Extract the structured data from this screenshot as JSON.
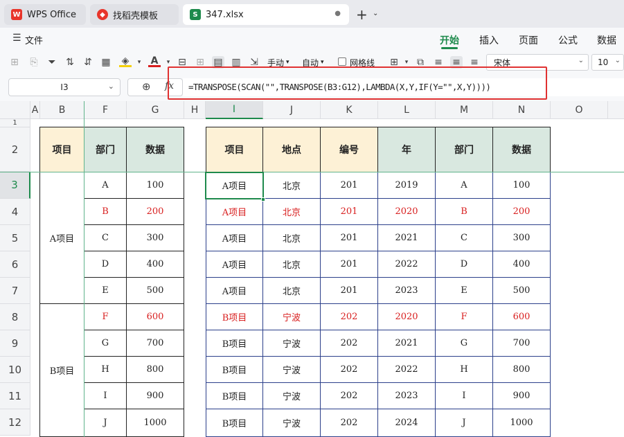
{
  "tabs": [
    {
      "label": "WPS Office",
      "icon": "wps-logo-icon"
    },
    {
      "label": "找稻壳模板",
      "icon": "docer-icon"
    },
    {
      "label": "347.xlsx",
      "icon": "sheet-icon"
    }
  ],
  "menu": {
    "file": "文件",
    "items": [
      "开始",
      "插入",
      "页面",
      "公式",
      "数据"
    ],
    "active": "开始"
  },
  "toolbar": {
    "wrap_manual": "手动",
    "wrap_auto": "自动",
    "gridlines": "网格线",
    "font_name": "宋体",
    "font_size": "10"
  },
  "formula": {
    "cell_ref": "I3",
    "fx": "fx",
    "text": "=TRANSPOSE(SCAN(\"\",TRANSPOSE(B3:G12),LAMBDA(X,Y,IF(Y=\"\",X,Y))))"
  },
  "columns": [
    "A",
    "B",
    "F",
    "G",
    "H",
    "I",
    "J",
    "K",
    "L",
    "M",
    "N",
    "O"
  ],
  "rows": [
    "1",
    "2",
    "3",
    "4",
    "5",
    "6",
    "7",
    "8",
    "9",
    "10",
    "11",
    "12"
  ],
  "left_table": {
    "headers": [
      "项目",
      "部门",
      "数据"
    ],
    "groups": [
      "A项目",
      "B项目"
    ],
    "dept": [
      "A",
      "B",
      "C",
      "D",
      "E",
      "F",
      "G",
      "H",
      "I",
      "J"
    ],
    "values": [
      "100",
      "200",
      "300",
      "400",
      "500",
      "600",
      "700",
      "800",
      "900",
      "1000"
    ]
  },
  "right_table": {
    "headers": [
      "项目",
      "地点",
      "编号",
      "年",
      "部门",
      "数据"
    ],
    "rows": [
      [
        "A项目",
        "北京",
        "201",
        "2019",
        "A",
        "100"
      ],
      [
        "A项目",
        "北京",
        "201",
        "2020",
        "B",
        "200"
      ],
      [
        "A项目",
        "北京",
        "201",
        "2021",
        "C",
        "300"
      ],
      [
        "A项目",
        "北京",
        "201",
        "2022",
        "D",
        "400"
      ],
      [
        "A项目",
        "北京",
        "201",
        "2023",
        "E",
        "500"
      ],
      [
        "B项目",
        "宁波",
        "202",
        "2020",
        "F",
        "600"
      ],
      [
        "B项目",
        "宁波",
        "202",
        "2021",
        "G",
        "700"
      ],
      [
        "B项目",
        "宁波",
        "202",
        "2022",
        "H",
        "800"
      ],
      [
        "B项目",
        "宁波",
        "202",
        "2023",
        "I",
        "900"
      ],
      [
        "B项目",
        "宁波",
        "202",
        "2024",
        "J",
        "1000"
      ]
    ]
  },
  "colors": {
    "header_yellow": "#fdf1d6",
    "header_green": "#d9e8e0",
    "red_text": "#d81e1e",
    "accent_green": "#1e8a4c",
    "highlight_border": "#e03131"
  }
}
